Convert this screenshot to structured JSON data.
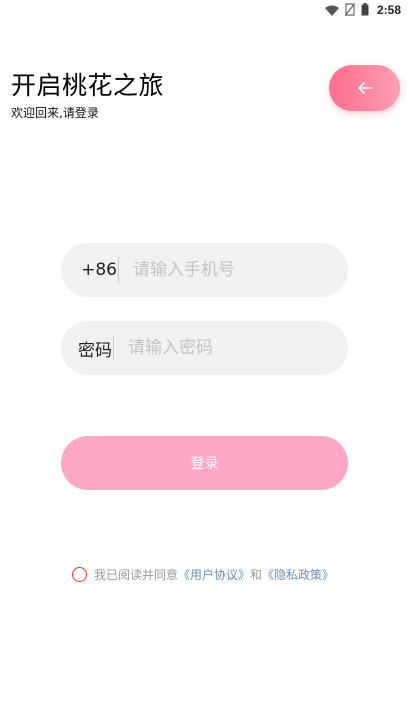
{
  "status_bar": {
    "time": "2:58",
    "icons": [
      "wifi-icon",
      "no-sim-icon",
      "battery-icon"
    ]
  },
  "header": {
    "title": "开启桃花之旅",
    "subtitle": "欢迎回来,请登录",
    "back_icon": "arrow-left-icon"
  },
  "form": {
    "phone": {
      "prefix": "+86",
      "placeholder": "请输入手机号",
      "value": ""
    },
    "password": {
      "prefix": "密码",
      "placeholder": "请输入密码",
      "value": ""
    },
    "login_label": "登录"
  },
  "agreement": {
    "text": "我已阅读并同意",
    "user_agreement": "《用户协议》",
    "and": "和",
    "privacy_policy": "《隐私政策》",
    "checked": false
  },
  "colors": {
    "accent_gradient_start": "#ff6d8c",
    "accent_gradient_end": "#ff9fb4",
    "login_button": "#ffa8c6",
    "field_background": "#f1f1f1",
    "link": "#6f8fb3",
    "checkbox_border": "#e23a3a"
  }
}
